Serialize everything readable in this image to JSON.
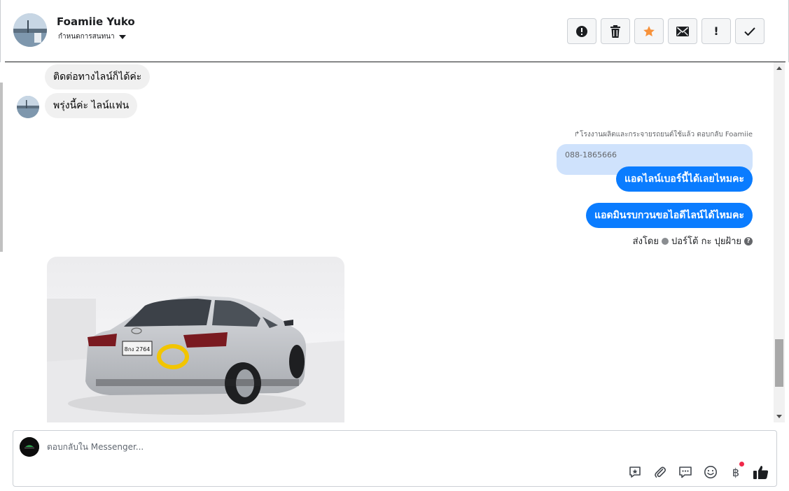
{
  "header": {
    "contact_name": "Foamiie Yuko",
    "assign_label": "กำหนดการสนทนา",
    "actions": [
      {
        "name": "report-spam-button",
        "icon": "alert-circle-icon"
      },
      {
        "name": "delete-button",
        "icon": "trash-icon"
      },
      {
        "name": "star-button",
        "icon": "star-icon"
      },
      {
        "name": "mark-unread-button",
        "icon": "envelope-icon"
      },
      {
        "name": "mark-important-button",
        "icon": "exclamation-icon"
      },
      {
        "name": "mark-done-button",
        "icon": "checkmark-icon"
      }
    ],
    "star_color": "#f7923b",
    "exclamation_glyph": "!"
  },
  "messages": {
    "incoming": [
      {
        "text": "ติดต่อทางไลน์ก็ได้ค่ะ"
      },
      {
        "text": "พรุ่งนี้ค่ะ ไลน์แฟน"
      }
    ],
    "reply_meta": "↱โรงงานผลิตและกระจายรถยนต์ใช้แล้ว ตอบกลับ Foamiie",
    "quoted_text": "088-1865666",
    "outgoing": [
      {
        "text": "แอดไลน์เบอร์นี้ได้เลยไหมคะ"
      },
      {
        "text": "แอดมินรบกวนขอไอดีไลน์ได้ไหมคะ"
      }
    ],
    "sent_by_prefix": "ส่งโดย",
    "sent_by_name": "ปอร์โต้ กะ ปุยฝ้าย",
    "help_glyph": "?",
    "photo": {
      "icon": "car-photo-icon",
      "plate_text": "8กง 2764"
    }
  },
  "composer": {
    "placeholder": "ตอบกลับใน Messenger...",
    "tools": [
      "saved-reply-icon",
      "paperclip-icon",
      "chat-bubble-icon",
      "emoji-icon",
      "baht-icon",
      "thumbs-up-icon"
    ],
    "baht_glyph": "฿",
    "accent": "#0a7cff"
  }
}
